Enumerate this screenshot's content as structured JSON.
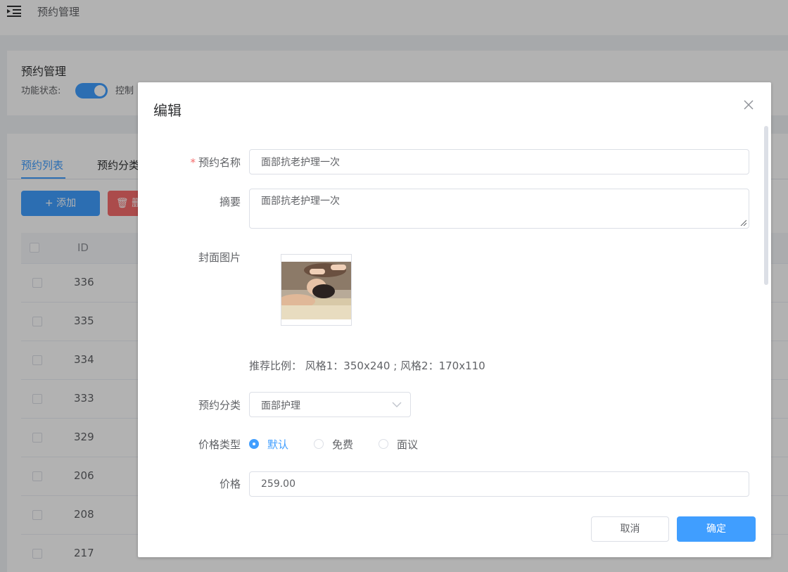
{
  "topbar": {
    "title": "预约管理",
    "menu_icon": "menu-fold-icon"
  },
  "header_card": {
    "title": "预约管理",
    "status_label": "功能状态:",
    "description": "控制"
  },
  "tabs": [
    {
      "label": "预约列表",
      "active": true
    },
    {
      "label": "预约分类",
      "active": false
    }
  ],
  "toolbar": {
    "add_label": "+ 添加",
    "delete_label": "删"
  },
  "table": {
    "id_header": "ID",
    "ids": [
      "336",
      "335",
      "334",
      "333",
      "329",
      "206",
      "208",
      "217"
    ]
  },
  "dialog": {
    "title": "编辑",
    "fields": {
      "name": {
        "label": "预约名称",
        "required_mark": "*",
        "value": "面部抗老护理一次"
      },
      "summary": {
        "label": "摘要",
        "value": "面部抗老护理一次"
      },
      "cover": {
        "label": "封面图片",
        "ratio_hint": "推荐比例：  风格1：350x240 ; 风格2：170x110"
      },
      "category": {
        "label": "预约分类",
        "selected": "面部护理"
      },
      "price_type": {
        "label": "价格类型",
        "options": [
          {
            "label": "默认",
            "checked": true
          },
          {
            "label": "免费",
            "checked": false
          },
          {
            "label": "面议",
            "checked": false
          }
        ]
      },
      "price": {
        "label": "价格",
        "value": "259.00"
      }
    },
    "cancel_label": "取消",
    "ok_label": "确定"
  },
  "colors": {
    "primary": "#409eff",
    "danger": "#f56c6c",
    "required": "#f56c6c"
  }
}
